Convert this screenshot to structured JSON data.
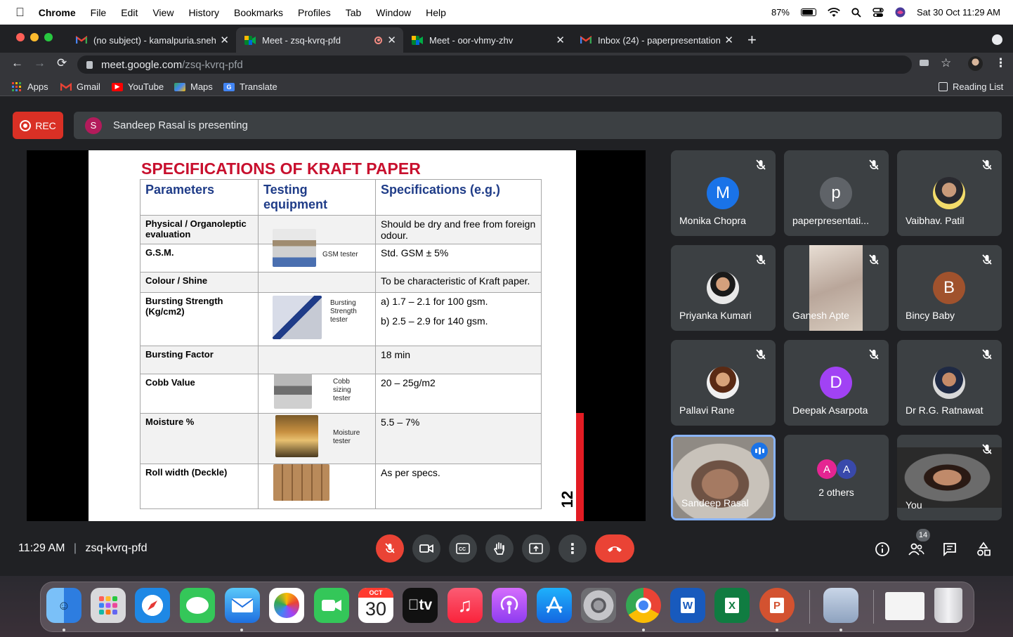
{
  "menubar": {
    "app": "Chrome",
    "items": [
      "File",
      "Edit",
      "View",
      "History",
      "Bookmarks",
      "Profiles",
      "Tab",
      "Window",
      "Help"
    ],
    "battery": "87%",
    "datetime": "Sat 30 Oct  11:29 AM"
  },
  "tabs": [
    {
      "title": "(no subject) - kamalpuria.sneh",
      "icon": "gmail-icon"
    },
    {
      "title": "Meet - zsq-kvrq-pfd",
      "icon": "meet-icon"
    },
    {
      "title": "Meet - oor-vhmy-zhv",
      "icon": "meet-icon"
    },
    {
      "title": "Inbox (24) - paperpresentation",
      "icon": "gmail-icon"
    }
  ],
  "address": {
    "host": "meet.google.com",
    "path": "/zsq-kvrq-pfd"
  },
  "bookmarks": [
    "Apps",
    "Gmail",
    "YouTube",
    "Maps",
    "Translate"
  ],
  "reading_list": "Reading List",
  "meet": {
    "rec": "REC",
    "presenter_initial": "S",
    "presenting": "Sandeep Rasal is presenting",
    "time": "11:29 AM",
    "separator": "|",
    "code": "zsq-kvrq-pfd",
    "participant_count": "14"
  },
  "slide": {
    "title": "SPECIFICATIONS OF KRAFT PAPER",
    "headers": [
      "Parameters",
      "Testing equipment",
      "Specifications (e.g.)"
    ],
    "rows": [
      {
        "param": "Physical / Organoleptic evaluation",
        "caption": "",
        "spec": "Should be dry and free from foreign odour."
      },
      {
        "param": "G.S.M.",
        "caption": "GSM tester",
        "spec": "Std. GSM ± 5%"
      },
      {
        "param": "Colour / Shine",
        "caption": "",
        "spec": "To be characteristic of Kraft paper."
      },
      {
        "param": "Bursting Strength (Kg/cm2)",
        "caption": "Bursting Strength tester",
        "spec": "a)  1.7 – 2.1 for 100 gsm.",
        "spec2": "b)  2.5 – 2.9 for 140 gsm."
      },
      {
        "param": "Bursting Factor",
        "caption": "",
        "spec": "18 min"
      },
      {
        "param": "Cobb Value",
        "caption": "Cobb sizing tester",
        "spec": "20 – 25g/m2"
      },
      {
        "param": "Moisture %",
        "caption": "Moisture tester",
        "spec": "5.5 – 7%"
      },
      {
        "param": "Roll width (Deckle)",
        "caption": "",
        "spec": "As per specs."
      }
    ],
    "page_number": "12"
  },
  "participants": [
    {
      "name": "Monika Chopra",
      "initial": "M",
      "color": "#1a73e8"
    },
    {
      "name": "paperpresentati...",
      "initial": "p",
      "color": "#5f6368"
    },
    {
      "name": "Vaibhav. Patil",
      "initial": "",
      "color": ""
    },
    {
      "name": "Priyanka Kumari",
      "initial": "",
      "color": ""
    },
    {
      "name": "Ganesh Apte",
      "initial": "",
      "color": ""
    },
    {
      "name": "Bincy Baby",
      "initial": "B",
      "color": "#a0522d"
    },
    {
      "name": "Pallavi Rane",
      "initial": "",
      "color": ""
    },
    {
      "name": "Deepak Asarpota",
      "initial": "D",
      "color": "#a142f4"
    },
    {
      "name": "Dr R.G. Ratnawat",
      "initial": "",
      "color": ""
    },
    {
      "name": "Sandeep Rasal",
      "initial": "",
      "color": ""
    },
    {
      "name": "2 others",
      "initial": "A",
      "color": "#e52592"
    },
    {
      "name": "You",
      "initial": "",
      "color": ""
    }
  ],
  "others_initial_2": "A",
  "dock": {
    "calendar_month": "OCT",
    "calendar_day": "30",
    "tv_label": "tv"
  }
}
